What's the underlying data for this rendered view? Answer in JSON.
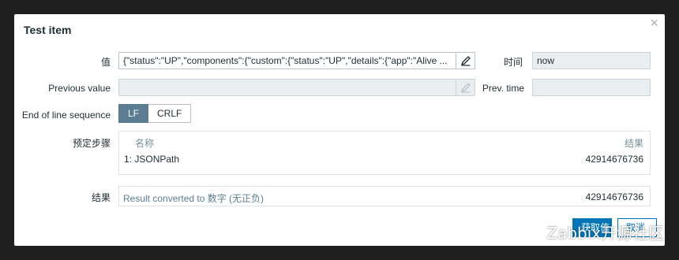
{
  "dialog": {
    "title": "Test item",
    "close_glyph": "×"
  },
  "form": {
    "value_label": "值",
    "value": "{\"status\":\"UP\",\"components\":{\"custom\":{\"status\":\"UP\",\"details\":{\"app\":\"Alive ...",
    "time_label": "时间",
    "time_value": "now",
    "previous_value_label": "Previous value",
    "previous_value": "",
    "prev_time_label": "Prev. time",
    "prev_time_value": "",
    "eol_label": "End of line sequence",
    "eol_options": [
      "LF",
      "CRLF"
    ],
    "eol_selected": "LF"
  },
  "steps": {
    "label": "预定步骤",
    "col_name": "名称",
    "col_result": "结果",
    "rows": [
      {
        "index": "1:",
        "name": "JSONPath",
        "result": "42914676736"
      }
    ]
  },
  "result": {
    "label": "结果",
    "text": "Result converted to 数字 (无正负)",
    "value": "42914676736"
  },
  "footer": {
    "primary_label": "获取值",
    "secondary_label": "取消"
  },
  "watermark": {
    "text": "Zabbix开源社区"
  },
  "colors": {
    "accent": "#0275b8",
    "segment_active": "#5c7d91",
    "header_text": "#768d99"
  }
}
